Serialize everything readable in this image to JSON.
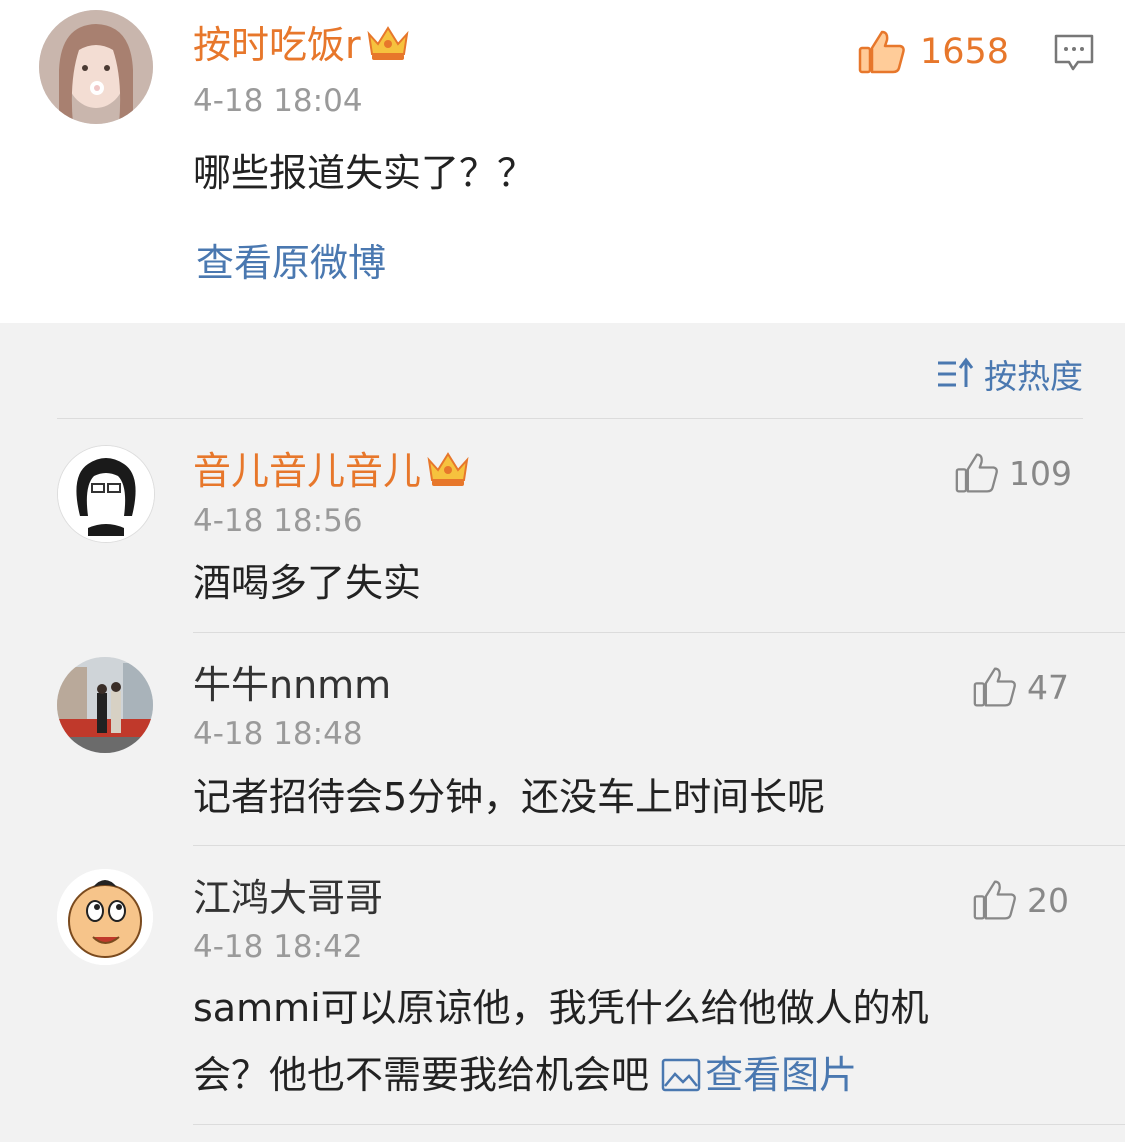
{
  "post": {
    "username": "按时吃饭r",
    "time": "4-18 18:04",
    "likes": "1658",
    "text": "哪些报道失实了？？",
    "view_original": "查看原微博"
  },
  "sort": {
    "label": "按热度"
  },
  "comments": [
    {
      "username": "音儿音儿音儿",
      "vip": true,
      "time": "4-18 18:56",
      "likes": "109",
      "text": "酒喝多了失实"
    },
    {
      "username": "牛牛nnmm",
      "vip": false,
      "time": "4-18 18:48",
      "likes": "47",
      "text": "记者招待会5分钟，还没车上时间长呢"
    },
    {
      "username": "江鸿大哥哥",
      "vip": false,
      "time": "4-18 18:42",
      "likes": "20",
      "text_line1": "sammi可以原谅他，我凭什么给他做人的机",
      "text_line2": "会？他也不需要我给机会吧",
      "image_link": "查看图片"
    }
  ],
  "colors": {
    "vip_name": "#e7772b",
    "link": "#4a78b0",
    "muted": "#9a9a9a"
  }
}
